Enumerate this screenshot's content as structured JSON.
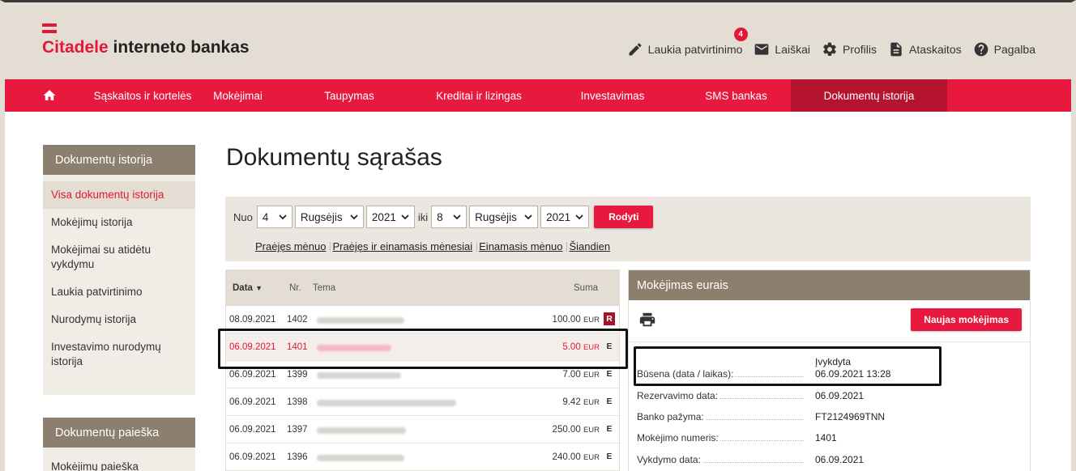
{
  "header": {
    "logo_brand": "Citadele",
    "logo_rest": "interneto bankas",
    "links": {
      "pending": "Laukia patvirtinimo",
      "pending_badge": "4",
      "messages": "Laiškai",
      "profile": "Profilis",
      "reports": "Ataskaitos",
      "help": "Pagalba"
    }
  },
  "nav": {
    "items": [
      "Sąskaitos ir kortelės",
      "Mokėjimai",
      "Taupymas",
      "Kreditai ir lizingas",
      "Investavimas",
      "SMS bankas",
      "Dokumentų istorija"
    ],
    "active": "Dokumentų istorija"
  },
  "sidebar": {
    "history_title": "Dokumentų istorija",
    "history_items": [
      "Visa dokumentų istorija",
      "Mokėjimų istorija",
      "Mokėjimai su atidėtu vykdymu",
      "Laukia patvirtinimo",
      "Nurodymų istorija",
      "Investavimo nurodymų istorija"
    ],
    "search_title": "Dokumentų paieška",
    "search_items": [
      "Mokėjimų paieška"
    ]
  },
  "main": {
    "title": "Dokumentų sąrašas",
    "filter": {
      "from_label": "Nuo",
      "from_day": "4",
      "from_month": "Rugsėjis",
      "from_year": "2021",
      "to_label": "iki",
      "to_day": "8",
      "to_month": "Rugsėjis",
      "to_year": "2021",
      "show_button": "Rodyti",
      "quick": [
        "Praėjęs mėnuo",
        "Praėjęs ir einamasis mėnesiai",
        "Einamasis mėnuo",
        "Šiandien"
      ]
    },
    "list": {
      "headers": {
        "date": "Data",
        "nr": "Nr.",
        "subject": "Tema",
        "sum": "Suma"
      },
      "rows": [
        {
          "date": "08.09.2021",
          "nr": "1402",
          "amount": "100.00",
          "currency": "EUR",
          "flag": "R"
        },
        {
          "date": "06.09.2021",
          "nr": "1401",
          "amount": "5.00",
          "currency": "EUR",
          "flag": "E"
        },
        {
          "date": "06.09.2021",
          "nr": "1399",
          "amount": "7.00",
          "currency": "EUR",
          "flag": "E"
        },
        {
          "date": "06.09.2021",
          "nr": "1398",
          "amount": "9.42",
          "currency": "EUR",
          "flag": "E"
        },
        {
          "date": "06.09.2021",
          "nr": "1397",
          "amount": "250.00",
          "currency": "EUR",
          "flag": "E"
        },
        {
          "date": "06.09.2021",
          "nr": "1396",
          "amount": "240.00",
          "currency": "EUR",
          "flag": "E"
        }
      ]
    },
    "detail": {
      "title": "Mokėjimas eurais",
      "new_payment": "Naujas mokėjimas",
      "status_value": "Įvykdyta",
      "fields": [
        {
          "label": "Būsena (data / laikas):",
          "value": "06.09.2021 13:28"
        },
        {
          "label": "Rezervavimo data:",
          "value": "06.09.2021"
        },
        {
          "label": "Banko pažyma:",
          "value": "FT2124969TNN"
        },
        {
          "label": "Mokėjimo numeris:",
          "value": "1401"
        },
        {
          "label": "Vykdymo data:",
          "value": "06.09.2021"
        }
      ]
    }
  },
  "colors": {
    "brand_red": "#e8193f",
    "nav_active": "#b5142f",
    "beige": "#e3ddd4",
    "panel_head": "#8c7f6e"
  }
}
